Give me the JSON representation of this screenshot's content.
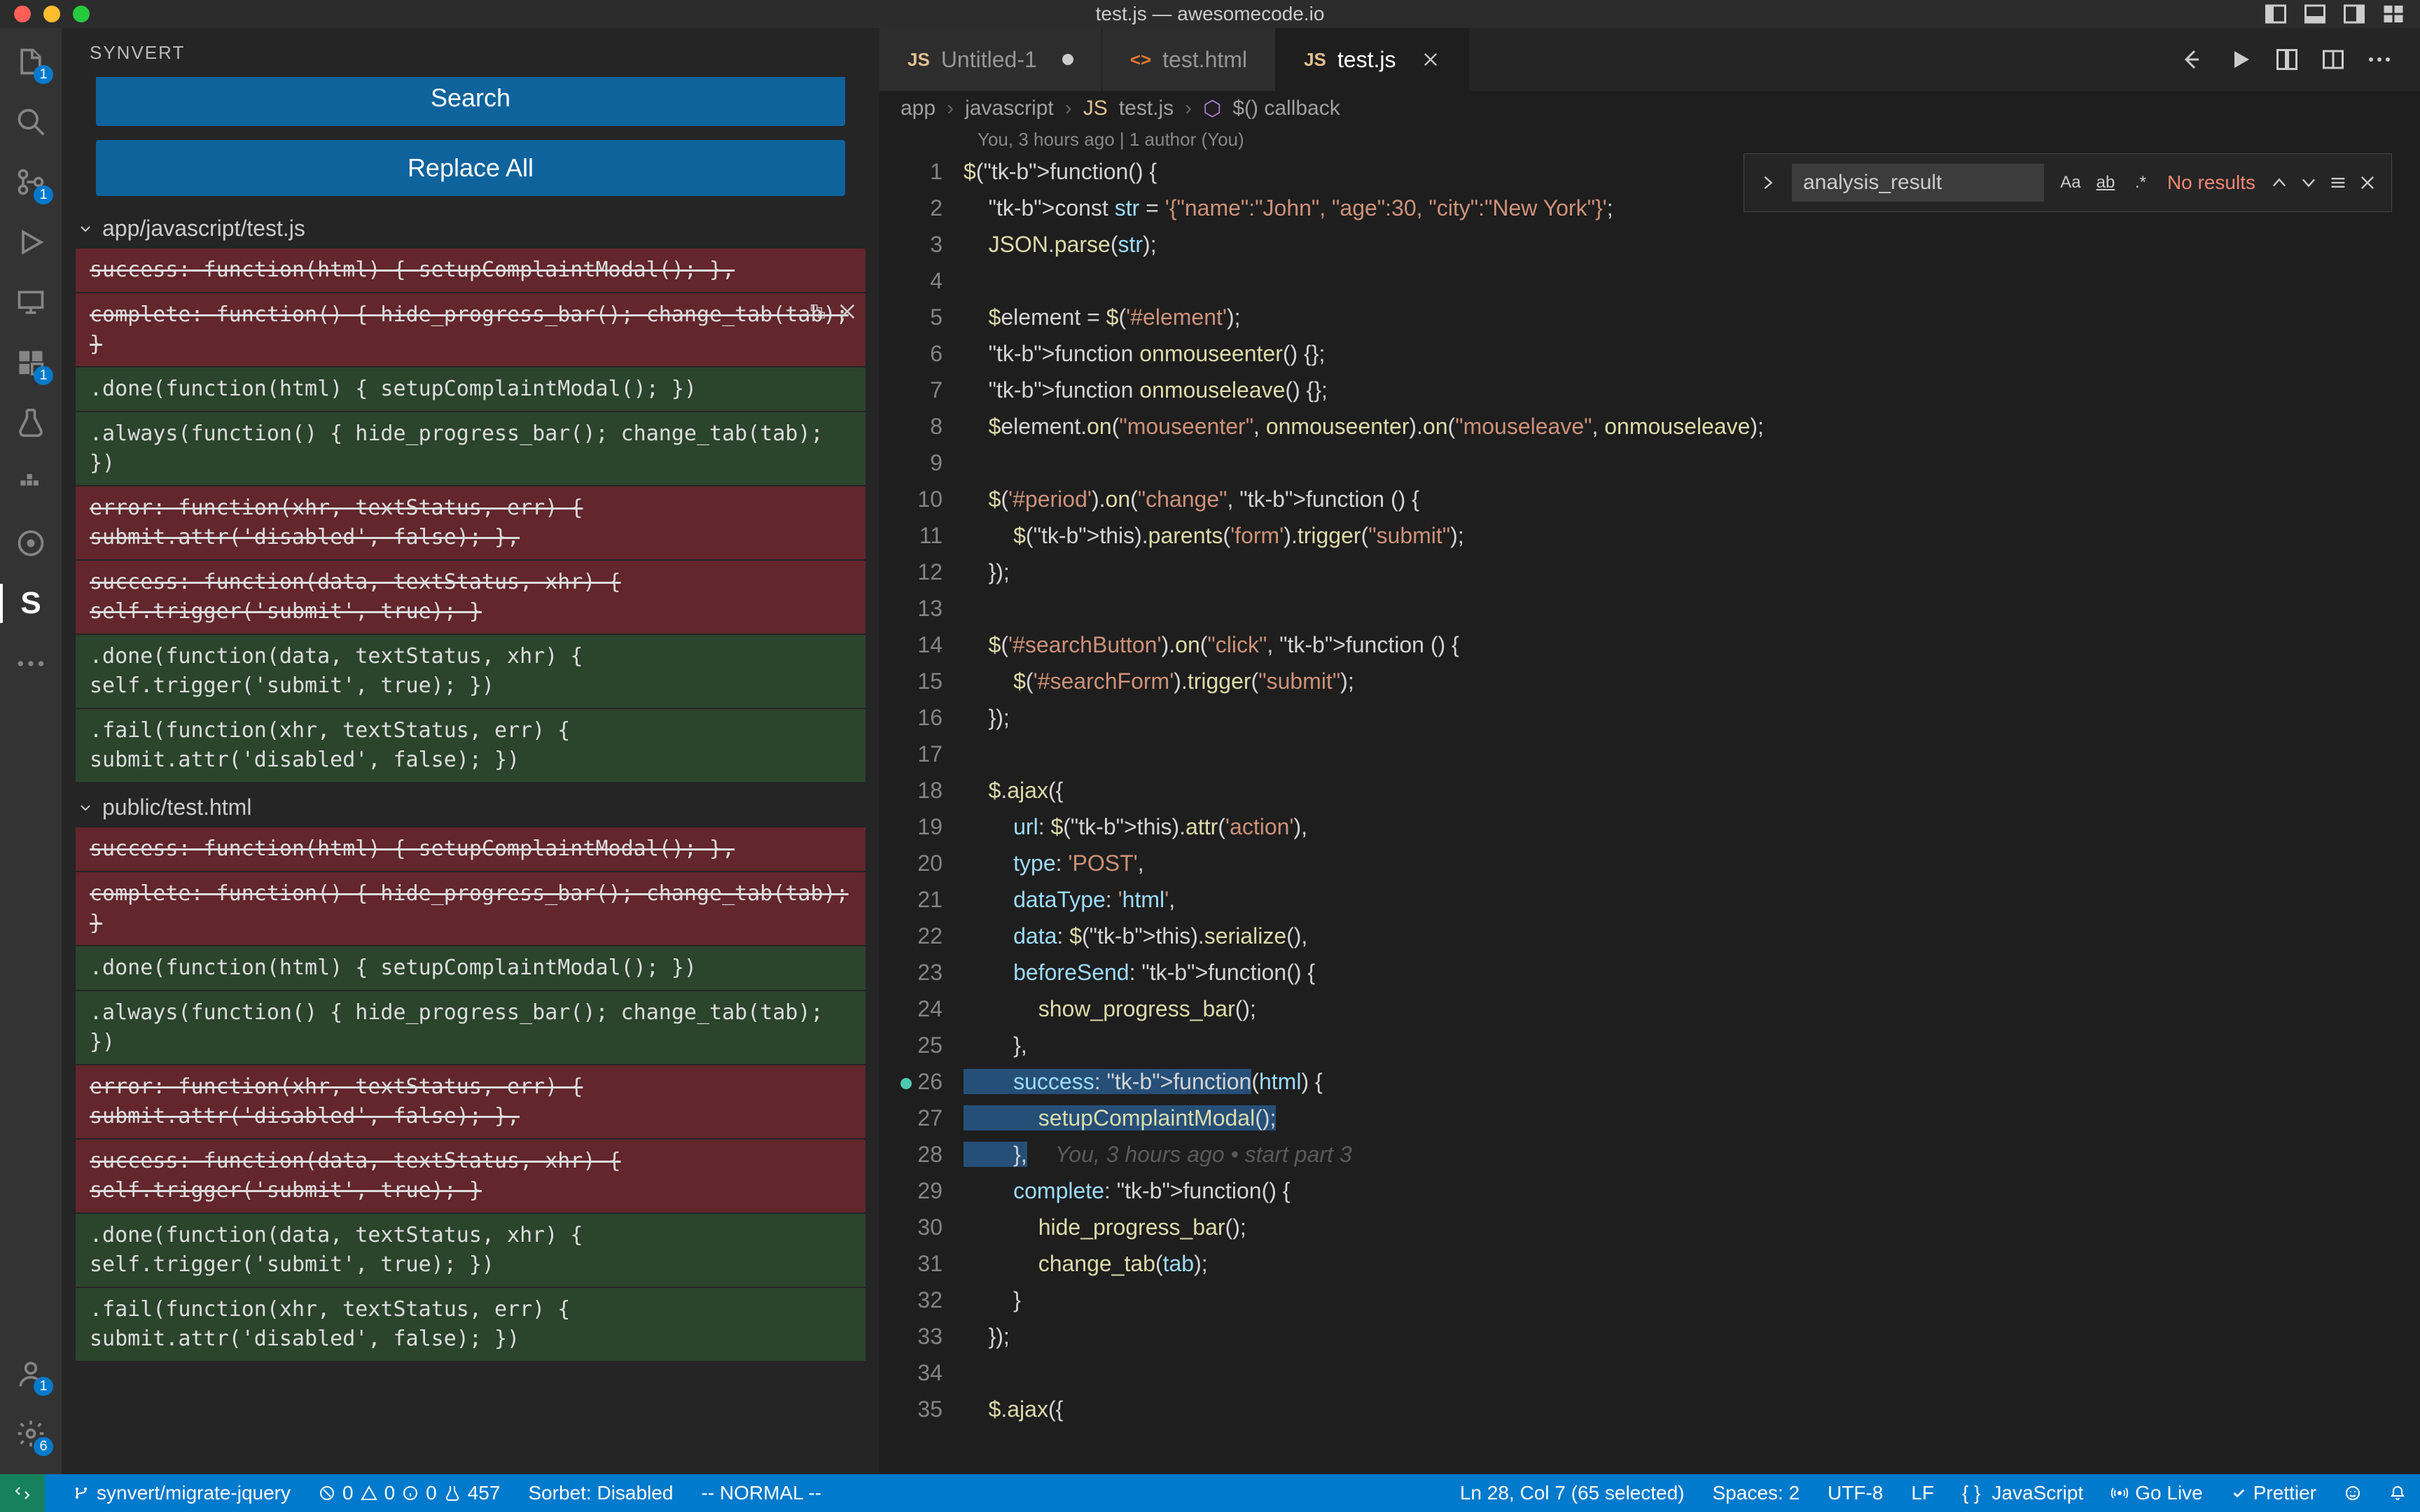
{
  "window": {
    "title": "test.js — awesomecode.io"
  },
  "sidebar": {
    "title": "SYNVERT",
    "search_label": "Search",
    "replace_all_label": "Replace All",
    "groups": [
      {
        "path": "app/javascript/test.js",
        "items": [
          {
            "kind": "delete",
            "text": "success: function(html) { setupComplaintModal(); },"
          },
          {
            "kind": "delete",
            "text": "complete: function() { hide_progress_bar(); change_tab(tab); }",
            "hovered": true
          },
          {
            "kind": "add",
            "text": ".done(function(html) { setupComplaintModal(); })"
          },
          {
            "kind": "add",
            "text": ".always(function() { hide_progress_bar(); change_tab(tab); })"
          },
          {
            "kind": "delete",
            "text": "error: function(xhr, textStatus, err) { submit.attr('disabled', false); },"
          },
          {
            "kind": "delete",
            "text": "success: function(data, textStatus, xhr) { self.trigger('submit', true); }"
          },
          {
            "kind": "add",
            "text": ".done(function(data, textStatus, xhr) { self.trigger('submit', true); })"
          },
          {
            "kind": "add",
            "text": ".fail(function(xhr, textStatus, err) { submit.attr('disabled', false); })"
          }
        ]
      },
      {
        "path": "public/test.html",
        "items": [
          {
            "kind": "delete",
            "text": "success: function(html) { setupComplaintModal(); },"
          },
          {
            "kind": "delete",
            "text": "complete: function() { hide_progress_bar(); change_tab(tab); }"
          },
          {
            "kind": "add",
            "text": ".done(function(html) { setupComplaintModal(); })"
          },
          {
            "kind": "add",
            "text": ".always(function() { hide_progress_bar(); change_tab(tab); })"
          },
          {
            "kind": "delete",
            "text": "error: function(xhr, textStatus, err) { submit.attr('disabled', false); },"
          },
          {
            "kind": "delete",
            "text": "success: function(data, textStatus, xhr) { self.trigger('submit', true); }"
          },
          {
            "kind": "add",
            "text": ".done(function(data, textStatus, xhr) { self.trigger('submit', true); })"
          },
          {
            "kind": "add",
            "text": ".fail(function(xhr, textStatus, err) { submit.attr('disabled', false); })"
          }
        ]
      }
    ]
  },
  "tabs": [
    {
      "label": "Untitled-1",
      "icon": "js",
      "dirty": true,
      "active": false
    },
    {
      "label": "test.html",
      "icon": "html",
      "dirty": false,
      "active": false
    },
    {
      "label": "test.js",
      "icon": "js",
      "dirty": false,
      "active": true
    }
  ],
  "breadcrumb": [
    "app",
    "javascript",
    "test.js",
    "$() callback"
  ],
  "gitlens_header": "You, 3 hours ago | 1 author (You)",
  "find": {
    "value": "analysis_result",
    "no_results": "No results"
  },
  "blame_inline": "You, 3 hours ago • start part 3",
  "code_lines": [
    "$(function() {",
    "    const str = '{\"name\":\"John\", \"age\":30, \"city\":\"New York\"}';",
    "    JSON.parse(str);",
    "",
    "    $element = $('#element');",
    "    function onmouseenter() {};",
    "    function onmouseleave() {};",
    "    $element.on(\"mouseenter\", onmouseenter).on(\"mouseleave\", onmouseleave);",
    "",
    "    $('#period').on(\"change\", function () {",
    "        $(this).parents('form').trigger(\"submit\");",
    "    });",
    "",
    "    $('#searchButton').on(\"click\", function () {",
    "        $('#searchForm').trigger(\"submit\");",
    "    });",
    "",
    "    $.ajax({",
    "        url: $(this).attr('action'),",
    "        type: 'POST',",
    "        dataType: 'html',",
    "        data: $(this).serialize(),",
    "        beforeSend: function() {",
    "            show_progress_bar();",
    "        },",
    "        success: function(html) {",
    "            setupComplaintModal();",
    "        },",
    "        complete: function() {",
    "            hide_progress_bar();",
    "            change_tab(tab);",
    "        }",
    "    });",
    "",
    "    $.ajax({"
  ],
  "statusbar": {
    "branch": "synvert/migrate-jquery",
    "errors": "0",
    "warnings": "0",
    "info": "0",
    "tests": "457",
    "sorbet": "Sorbet: Disabled",
    "mode": "-- NORMAL --",
    "cursor": "Ln 28, Col 7 (65 selected)",
    "spaces": "Spaces: 2",
    "encoding": "UTF-8",
    "eol": "LF",
    "language": "JavaScript",
    "golive": "Go Live",
    "prettier": "Prettier"
  },
  "activity_badges": {
    "explorer": "1",
    "scm": "1",
    "extensions": "1",
    "account": "1",
    "settings": "6"
  }
}
